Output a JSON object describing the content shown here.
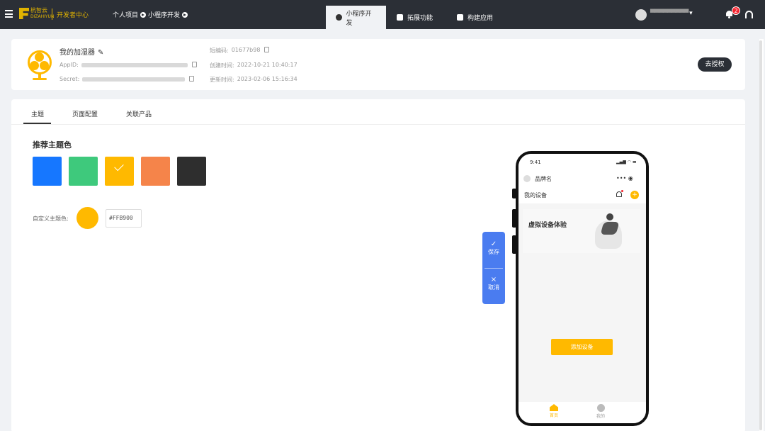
{
  "topbar": {
    "logo_text": "杭智云",
    "logo_sub": "DIZAHIYUN",
    "dev_center": "开发者中心",
    "nav": [
      "个人项目",
      "小程序开发"
    ],
    "tabs": [
      {
        "label": "小程序开发",
        "active": true,
        "icon": "palette-icon"
      },
      {
        "label": "拓展功能",
        "active": false,
        "icon": "extend-icon"
      },
      {
        "label": "构建应用",
        "active": false,
        "icon": "build-icon"
      }
    ],
    "user_name": "▀▀▀▀▀▀▀▀▀",
    "notification_count": "2"
  },
  "app_info": {
    "name": "我的加湿器",
    "appid_label": "AppID:",
    "secret_label": "Secret:",
    "short_code_label": "短编码:",
    "short_code": "01677b98",
    "created_label": "创建时间:",
    "created": "2022-10-21 10:40:17",
    "updated_label": "更新时间:",
    "updated": "2023-02-06 15:16:34",
    "auth_button": "去授权"
  },
  "tabs": [
    "主题",
    "页面配置",
    "关联产品"
  ],
  "theme": {
    "section_title": "推荐主题色",
    "swatches": [
      "#1677ff",
      "#3ec97c",
      "#ffb900",
      "#f5844a",
      "#2e2e2e"
    ],
    "selected_index": 2,
    "custom_label": "自定义主题色:",
    "custom_color": "#FFB900"
  },
  "float_actions": {
    "save": "保存",
    "cancel": "取消"
  },
  "phone": {
    "time": "9:41",
    "brand": "品牌名",
    "my_devices": "我的设备",
    "banner_text": "虚拟设备体验",
    "add_device": "添加设备",
    "nav_home": "首页",
    "nav_me": "我的"
  }
}
